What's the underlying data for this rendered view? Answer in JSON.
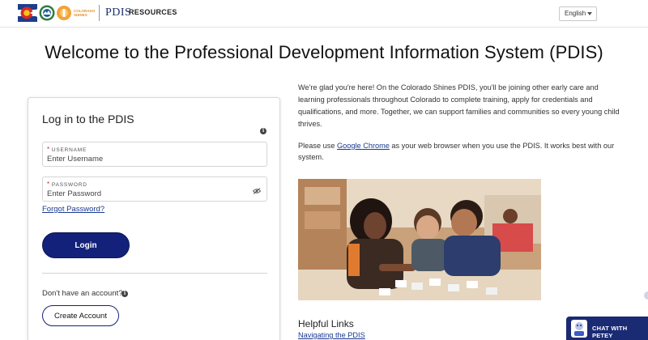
{
  "header": {
    "shines_text": "COLORADO SHINES",
    "brand_name": "PDIS",
    "nav_resources": "RESOURCES",
    "language": "English"
  },
  "page_title": "Welcome to the Professional Development Information System (PDIS)",
  "login": {
    "title": "Log in to the PDIS",
    "username_label": "USERNAME",
    "username_placeholder": "Enter Username",
    "password_label": "PASSWORD",
    "password_placeholder": "Enter Password",
    "forgot_link": "Forgot Password?",
    "login_button": "Login",
    "no_account_text": "Don't have an account?",
    "create_account_button": "Create Account"
  },
  "content": {
    "intro": "We're glad you're here! On the Colorado Shines PDIS, you'll be joining other early care and learning professionals throughout Colorado to complete training, apply for credentials and qualifications, and more. Together, we can support families and communities so every young child thrives.",
    "chrome_prefix": "Please use ",
    "chrome_link": "Google Chrome",
    "chrome_suffix": " as your web browser when you use the PDIS. It works best with our system.",
    "helpful_links_title": "Helpful Links",
    "helpful_links": [
      {
        "label": "Navigating the PDIS"
      }
    ]
  },
  "chat": {
    "label": "CHAT WITH PETEY"
  },
  "colors": {
    "primary_navy": "#14217a",
    "link_blue": "#1a3a8f",
    "required_red": "#c62828",
    "chat_navy": "#1a2a73"
  },
  "icons": [
    "colorado-flag-logo-icon",
    "state-seal-logo-icon",
    "colorado-shines-logo-icon",
    "info-icon",
    "eye-slash-icon",
    "chevron-down-icon",
    "petey-avatar-icon"
  ]
}
